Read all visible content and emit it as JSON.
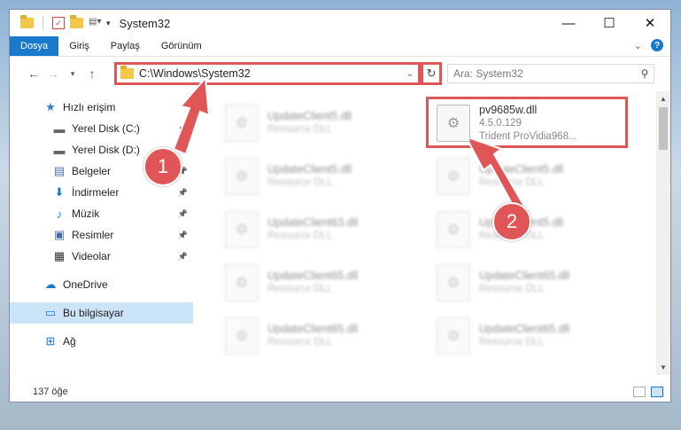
{
  "window": {
    "title": "System32"
  },
  "window_buttons": {
    "minimize": "—",
    "maximize": "☐",
    "close": "✕"
  },
  "ribbon": {
    "tabs": [
      {
        "label": "Dosya",
        "active": true
      },
      {
        "label": "Giriş"
      },
      {
        "label": "Paylaş"
      },
      {
        "label": "Görünüm"
      }
    ],
    "expand": "⌄",
    "help": "?"
  },
  "address": {
    "path": "C:\\Windows\\System32"
  },
  "search": {
    "placeholder": "Ara: System32"
  },
  "sidebar": {
    "items": [
      {
        "label": "Hızlı erişim",
        "icon": "star-icon",
        "glyph": "★",
        "color": "#3a7bd5"
      },
      {
        "label": "Yerel Disk (C:)",
        "icon": "drive-icon",
        "glyph": "▬",
        "color": "#666",
        "pin": true
      },
      {
        "label": "Yerel Disk (D:)",
        "icon": "drive-icon",
        "glyph": "▬",
        "color": "#666",
        "pin": true
      },
      {
        "label": "Belgeler",
        "icon": "documents-icon",
        "glyph": "▤",
        "color": "#4a6fa5",
        "pin": true
      },
      {
        "label": "İndirmeler",
        "icon": "download-icon",
        "glyph": "⬇",
        "color": "#1979ca",
        "pin": true
      },
      {
        "label": "Müzik",
        "icon": "music-icon",
        "glyph": "♪",
        "color": "#1979ca",
        "pin": true
      },
      {
        "label": "Resimler",
        "icon": "pictures-icon",
        "glyph": "▣",
        "color": "#4a6fa5",
        "pin": true
      },
      {
        "label": "Videolar",
        "icon": "video-icon",
        "glyph": "▦",
        "color": "#333",
        "pin": true
      },
      {
        "label": "OneDrive",
        "icon": "cloud-icon",
        "glyph": "☁",
        "color": "#1979ca"
      },
      {
        "label": "Bu bilgisayar",
        "icon": "computer-icon",
        "glyph": "▭",
        "color": "#1979ca",
        "selected": true
      },
      {
        "label": "Ağ",
        "icon": "network-icon",
        "glyph": "⊞",
        "color": "#1979ca"
      }
    ]
  },
  "files": {
    "left": [
      {
        "name": "UpdateClient5.dll",
        "sub": "Resource DLL"
      },
      {
        "name": "UpdateClient5.dll",
        "sub": "Resource DLL"
      },
      {
        "name": "UpdateClient63.dll",
        "sub": "Resource DLL"
      },
      {
        "name": "UpdateClient65.dll",
        "sub": "Resource DLL"
      },
      {
        "name": "UpdateClient65.dll",
        "sub": "Resource DLL"
      }
    ],
    "right": [
      {
        "name": "pv9685w.dll",
        "sub": "4.5.0.129",
        "sub2": "Trident ProVidia968...",
        "highlight": true
      },
      {
        "name": "UpdateClient5.dll",
        "sub": "Resource DLL"
      },
      {
        "name": "UpdateClient5.dll",
        "sub": "Resource DLL"
      },
      {
        "name": "UpdateClient65.dll",
        "sub": "Resource DLL"
      },
      {
        "name": "UpdateClient65.dll",
        "sub": "Resource DLL"
      }
    ]
  },
  "status": {
    "count": "137 öğe"
  },
  "markers": {
    "one": "1",
    "two": "2"
  },
  "colors": {
    "accent": "#1979ca",
    "annotation": "#e05555"
  }
}
